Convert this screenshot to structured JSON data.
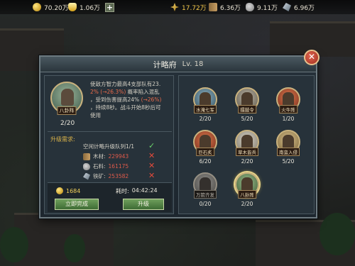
{
  "resources": {
    "coins": "70.20万",
    "gold": "1.06万",
    "wheat": "17.72万",
    "wood": "6.36万",
    "stone": "9.11万",
    "ore": "6.96万"
  },
  "dialog": {
    "title": "计略府",
    "level": "Lv. 18"
  },
  "main_skill": {
    "name": "八卦阵",
    "count": "2/20",
    "desc_line1": "使敌方智力最高4支部队有23.",
    "desc_line2_a": "2%",
    "desc_line2_b": "(→26.3%)",
    "desc_line2_c": "概率陷入混乱",
    "desc_line3_a": "，受到伤害提高24%",
    "desc_line3_b": "(→26%)",
    "desc_line4": "，持续8秒。战斗开始8秒后可",
    "desc_line5": "使用"
  },
  "requirements": {
    "label": "升级需求:",
    "queue": "空闲计略升级队列1/1",
    "wood_label": "木材:",
    "wood_value": "229943",
    "stone_label": "石料:",
    "stone_value": "161175",
    "ore_label": "铁矿:",
    "ore_value": "253582"
  },
  "cost": {
    "gold": "1684",
    "time_label": "耗时:",
    "time": "04:42:24"
  },
  "buttons": {
    "speedup": "立即完成",
    "upgrade": "升级"
  },
  "skills": [
    {
      "name": "水淹七军",
      "count": "2/20"
    },
    {
      "name": "擂鼓令",
      "count": "5/20"
    },
    {
      "name": "火牛阵",
      "count": "1/20"
    },
    {
      "name": "巨石炙",
      "count": "6/20"
    },
    {
      "name": "草木皆兵",
      "count": "2/20"
    },
    {
      "name": "南蛮入侵",
      "count": "5/20"
    },
    {
      "name": "万箭齐发",
      "count": "0/20"
    },
    {
      "name": "八卦阵",
      "count": "2/20"
    }
  ],
  "colors": {
    "accent_red": "#e05a4a",
    "ok_green": "#6bd36b",
    "button_green": "#3d6b34",
    "gold_yellow": "#f0cf5a"
  }
}
